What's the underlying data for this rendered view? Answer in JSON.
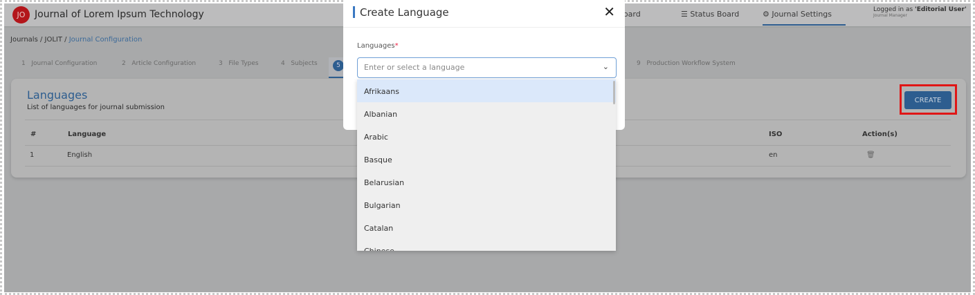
{
  "header": {
    "logo": "JO",
    "title": "Journal of Lorem Ipsum Technology",
    "nav": [
      {
        "label": "Dashboard",
        "icon": "dashboard-icon"
      },
      {
        "label": "Status Board",
        "icon": "status-board-icon"
      },
      {
        "label": "Journal Settings",
        "icon": "settings-icon"
      }
    ],
    "user": {
      "prefix": "Logged in as ",
      "name": "'Editorial User'",
      "role": "Journal Manager"
    }
  },
  "breadcrumb": [
    "Journals",
    "JOLIT",
    "Journal Configuration"
  ],
  "steps": [
    {
      "n": "1",
      "label": "Journal Configuration"
    },
    {
      "n": "2",
      "label": "Article Configuration"
    },
    {
      "n": "3",
      "label": "File Types"
    },
    {
      "n": "4",
      "label": "Subjects"
    },
    {
      "n": "5",
      "label": ""
    },
    {
      "n": "9",
      "label": "Production Workflow System"
    }
  ],
  "card": {
    "title": "Languages",
    "subtitle": "List of languages for journal submission",
    "create": "CREATE",
    "columns": [
      "#",
      "Language",
      "ISO",
      "Action(s)"
    ],
    "rows": [
      {
        "num": "1",
        "language": "English",
        "iso": "en"
      }
    ]
  },
  "modal": {
    "title": "Create Language",
    "field_label": "Languages",
    "required": "*",
    "placeholder": "Enter or select a language",
    "options": [
      "Afrikaans",
      "Albanian",
      "Arabic",
      "Basque",
      "Belarusian",
      "Bulgarian",
      "Catalan",
      "Chinese"
    ]
  }
}
